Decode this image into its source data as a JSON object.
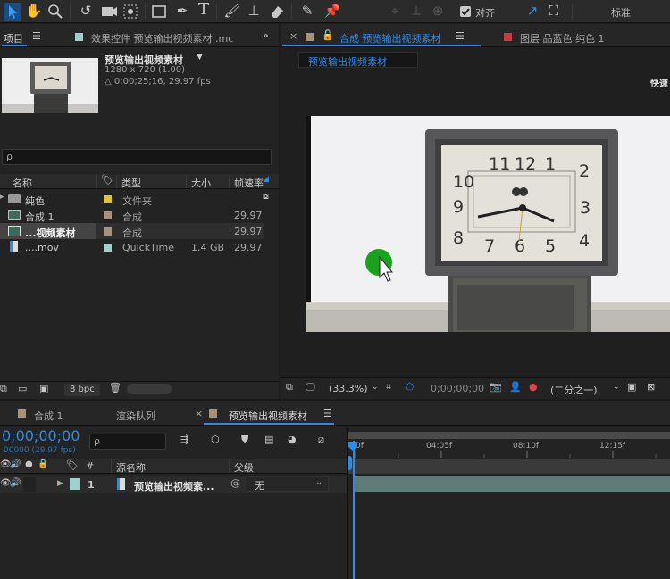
{
  "toolbar": {
    "snap_label": "对齐",
    "workspace_label": "标准",
    "icons": [
      "select-tool",
      "hand-tool",
      "zoom-tool",
      "rotate-tool",
      "camera-tool",
      "pan-behind-tool",
      "rectangle-tool",
      "pen-tool",
      "type-tool",
      "brush-tool",
      "clone-stamp-tool",
      "eraser-tool",
      "roto-brush-tool",
      "puppet-tool"
    ]
  },
  "project": {
    "tab_label": "项目",
    "effects_tab": "效果控件 预览输出视频素材 .mc",
    "item_name": "预览输出视频素材",
    "item_size": "1280 x 720 (1.00)",
    "item_duration": "△ 0;00;25;16, 29.97 fps",
    "search_placeholder": "ρ",
    "columns": {
      "name": "名称",
      "type": "类型",
      "size": "大小",
      "fps": "帧速率"
    },
    "rows": [
      {
        "name": "纯色",
        "type": "文件夹",
        "size": "",
        "fps": "",
        "color": "#e6c23a",
        "icon": "folder"
      },
      {
        "name": "合成 1",
        "type": "合成",
        "size": "",
        "fps": "29.97",
        "color": "#a8937a",
        "icon": "comp"
      },
      {
        "name": "...视频素材",
        "type": "合成",
        "size": "",
        "fps": "29.97",
        "color": "#a8937a",
        "icon": "comp"
      },
      {
        "name": "....mov",
        "type": "QuickTime",
        "size": "1.4 GB",
        "fps": "29.97",
        "color": "#9fd0cc",
        "icon": "file"
      }
    ],
    "bpc": "8 bpc"
  },
  "composition": {
    "tab_label": "合成 预览输出视频素材",
    "layer_tab": "图层 品蓝色 纯色 1",
    "breadcrumb": "预览输出视频素材",
    "fast_preview": "快速",
    "zoom": "(33.3%)",
    "timecode": "0;00;00;00",
    "resolution": "(二分之一)",
    "clock_numbers": [
      "11",
      "12",
      "1",
      "2",
      "10",
      "3",
      "9",
      "8",
      "7",
      "6",
      "5",
      "4"
    ]
  },
  "timeline": {
    "tabs": [
      "合成 1",
      "渲染队列",
      "预览输出视频素材"
    ],
    "timecode": "0;00;00;00",
    "frame_info": "00000 (29.97 fps)",
    "search_placeholder": "ρ",
    "col_index": "#",
    "col_source": "源名称",
    "col_parent": "父级",
    "ruler": [
      "0f",
      "04:05f",
      "08:10f",
      "12:15f"
    ],
    "layer": {
      "index": "1",
      "name": "预览输出视频素...",
      "parent": "无"
    }
  },
  "colors": {
    "accent": "#2d8ceb",
    "track": "#5d7c79",
    "panel": "#232323"
  }
}
